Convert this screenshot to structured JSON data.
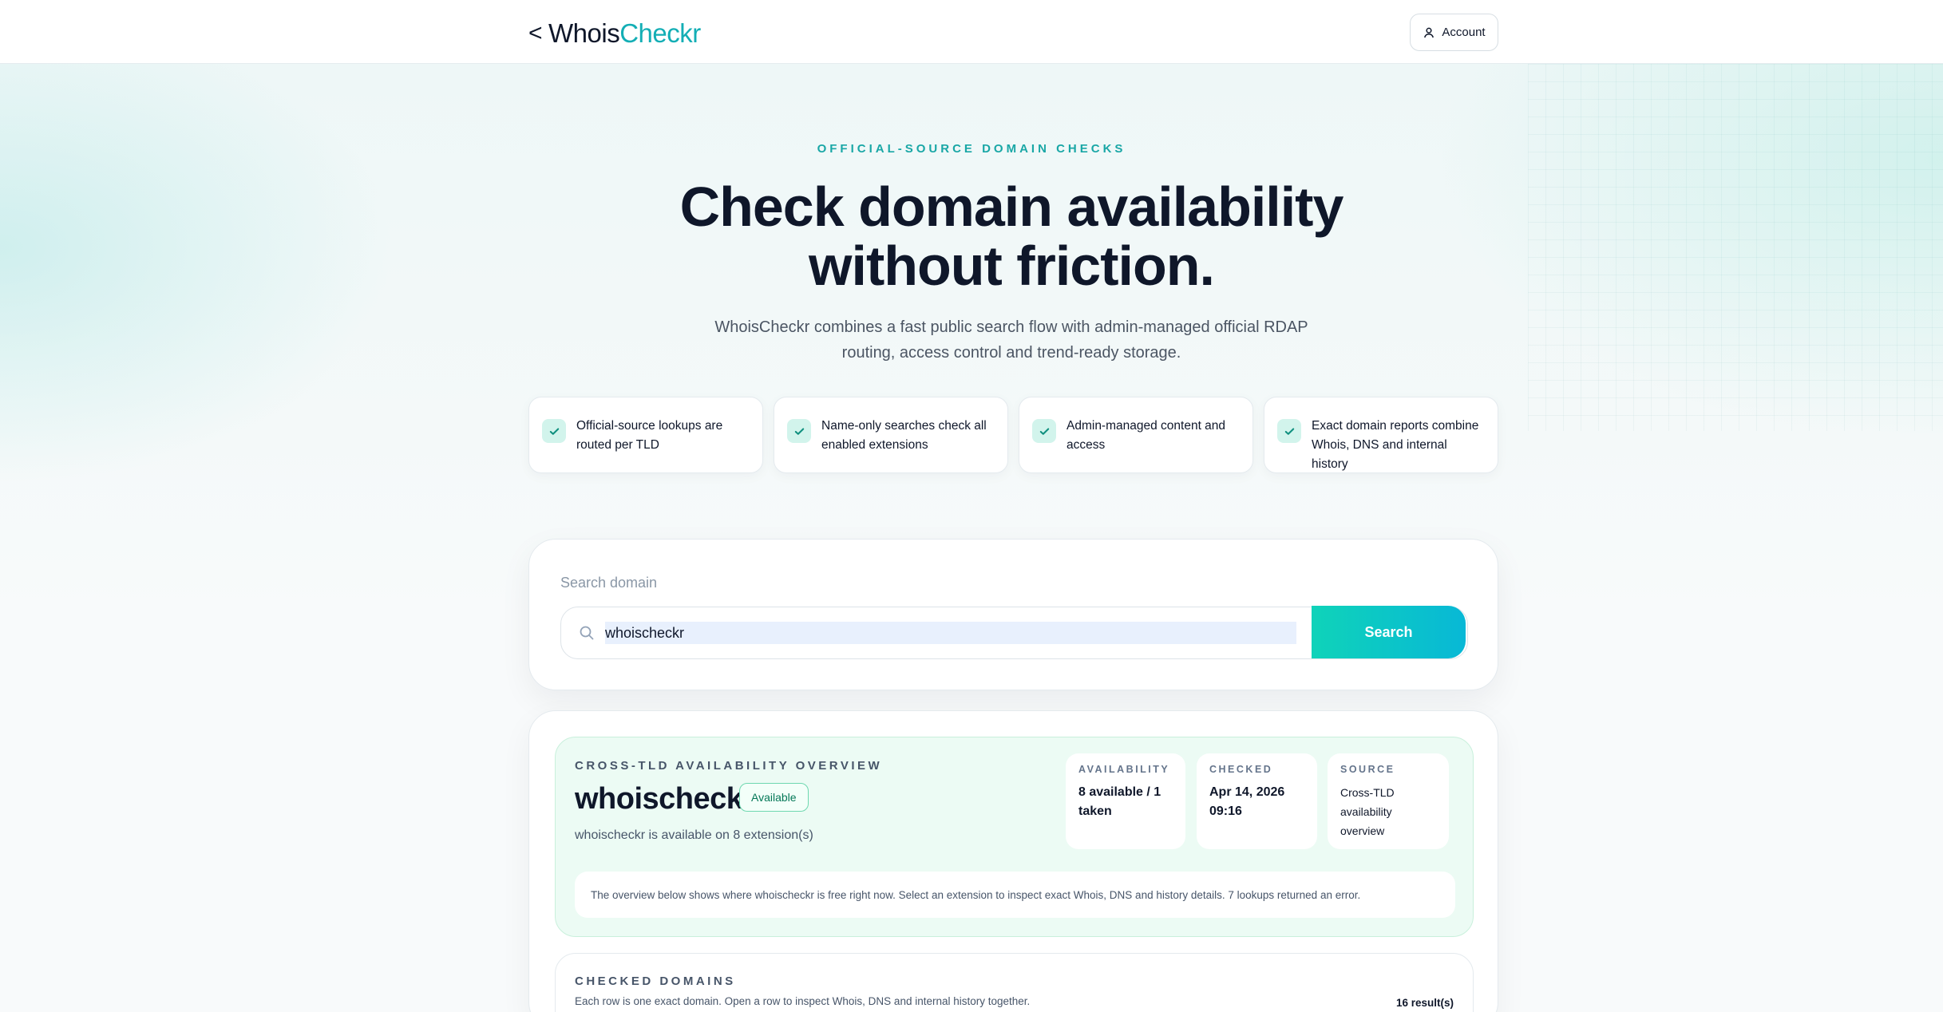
{
  "brand": {
    "prefix": "<",
    "name_part1": "Whois",
    "name_part2": "Checkr"
  },
  "header": {
    "account_label": "Account"
  },
  "hero": {
    "eyebrow": "OFFICIAL-SOURCE DOMAIN CHECKS",
    "title_line1": "Check domain availability",
    "title_line2": "without friction.",
    "subtitle_line1": "WhoisCheckr combines a fast public search flow with admin-managed official RDAP",
    "subtitle_line2": "routing, access control and trend-ready storage."
  },
  "features": [
    {
      "icon": "check-icon",
      "line1": "Official-source lookups are",
      "line2": "routed per TLD",
      "line3": ""
    },
    {
      "icon": "check-icon",
      "line1": "Name-only searches check all",
      "line2": "enabled extensions",
      "line3": ""
    },
    {
      "icon": "check-icon",
      "line1": "Admin-managed content and",
      "line2": "access",
      "line3": ""
    },
    {
      "icon": "check-icon",
      "line1": "Exact domain reports combine",
      "line2": "Whois, DNS and internal",
      "line3": "history"
    }
  ],
  "search": {
    "label": "Search domain",
    "value": "whoischeckr",
    "button_label": "Search"
  },
  "overview": {
    "eyebrow": "CROSS-TLD AVAILABILITY OVERVIEW",
    "domain": "whoischeckr",
    "badge": "Available",
    "summary": "whoischeckr is available on 8 extension(s)",
    "stats": {
      "availability_label": "AVAILABILITY",
      "availability_line1": "8 available / 1",
      "availability_line2": "taken",
      "checked_label": "CHECKED",
      "checked_line1": "Apr 14, 2026",
      "checked_line2": "09:16",
      "source_label": "SOURCE",
      "source_line1": "Cross-TLD",
      "source_line2": "availability",
      "source_line3": "overview"
    },
    "note": "The overview below shows where whoischeckr is free right now. Select an extension to inspect exact Whois, DNS and history details. 7 lookups returned an error."
  },
  "checked_domains": {
    "eyebrow": "CHECKED DOMAINS",
    "subtitle": "Each row is one exact domain. Open a row to inspect Whois, DNS and internal history together.",
    "count": "16 result(s)"
  },
  "colors": {
    "accent": "#13aeb5",
    "button_start": "#0fd3b9",
    "button_end": "#08b8d6",
    "success_bg": "#ecfbf4"
  }
}
